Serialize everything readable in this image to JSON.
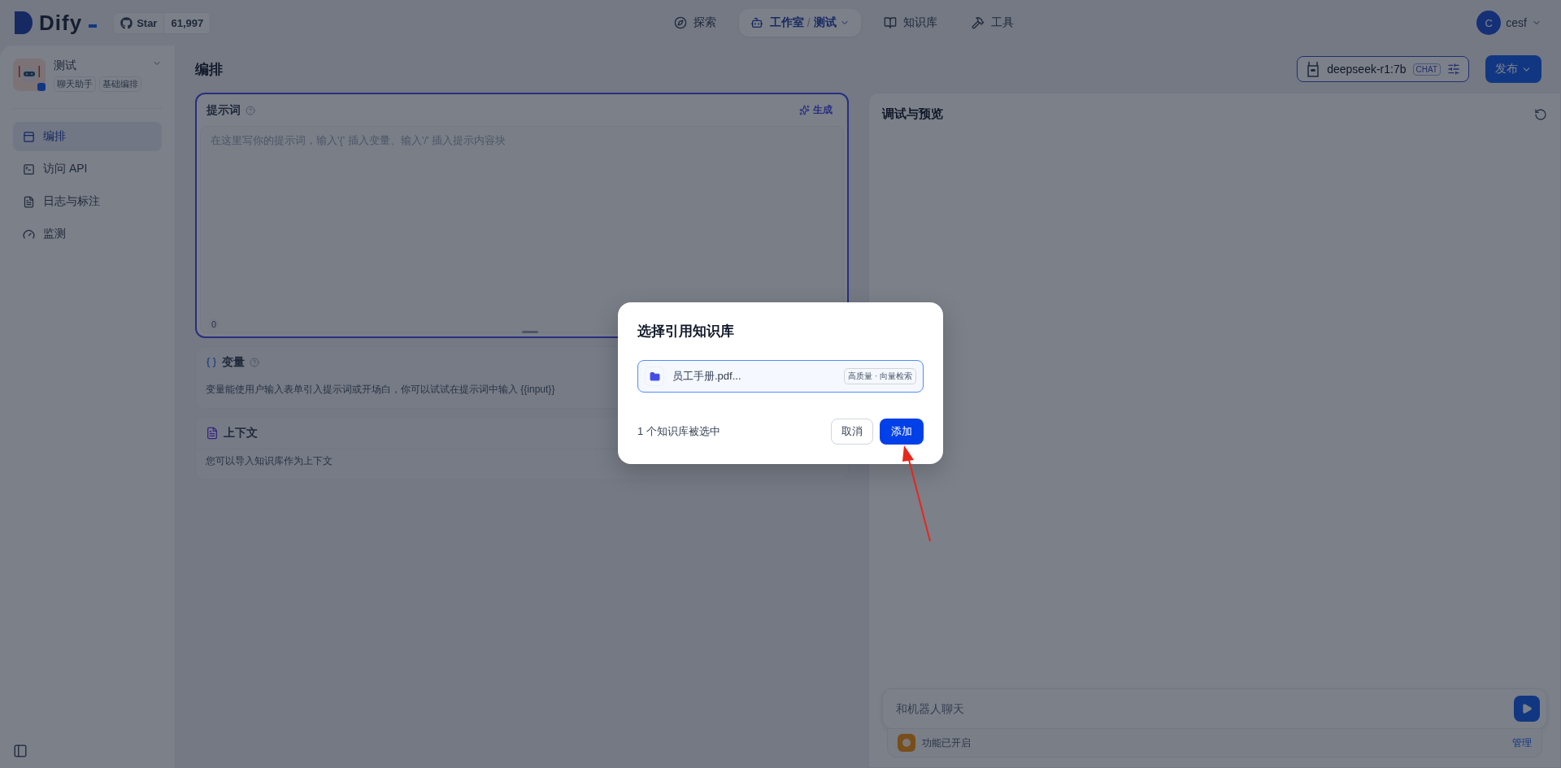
{
  "brand": {
    "logo": "Dify",
    "star_label": "Star",
    "star_count": "61,997"
  },
  "nav": [
    {
      "label": "探索",
      "selected": false
    },
    {
      "label": "工作室",
      "selected": true,
      "separator": "/",
      "breadcrumb": "测试"
    },
    {
      "label": "知识库",
      "selected": false
    },
    {
      "label": "工具",
      "selected": false
    }
  ],
  "user": {
    "avatar": "C",
    "name": "cesf"
  },
  "app": {
    "name": "测试",
    "tags": [
      "聊天助手",
      "基础编排"
    ]
  },
  "sidebar": {
    "items": [
      {
        "label": "编排",
        "selected": true
      },
      {
        "label": "访问 API",
        "selected": false
      },
      {
        "label": "日志与标注",
        "selected": false
      },
      {
        "label": "监测",
        "selected": false
      }
    ]
  },
  "page_title": "编排",
  "model": {
    "name": "deepseek-r1:7b",
    "badge": "CHAT"
  },
  "publish_button": "发布",
  "prompt": {
    "title": "提示词",
    "generate": "生成",
    "placeholder": "在这里写你的提示词，输入'{' 插入变量、输入'/' 插入提示内容块",
    "count": "0"
  },
  "variables": {
    "title": "变量",
    "description": "变量能使用户输入表单引入提示词或开场白，你可以试试在提示词中输入 {{input}}"
  },
  "context": {
    "title": "上下文",
    "description": "您可以导入知识库作为上下文"
  },
  "preview": {
    "title": "调试与预览",
    "chat_placeholder": "和机器人聊天",
    "features": "功能已开启",
    "manage": "管理"
  },
  "dialog": {
    "title": "选择引用知识库",
    "items": [
      {
        "name": "员工手册.pdf...",
        "badge": "高质量 · 向量检索",
        "selected": true
      }
    ],
    "count_text": "1 个知识库被选中",
    "cancel": "取消",
    "confirm": "添加"
  }
}
